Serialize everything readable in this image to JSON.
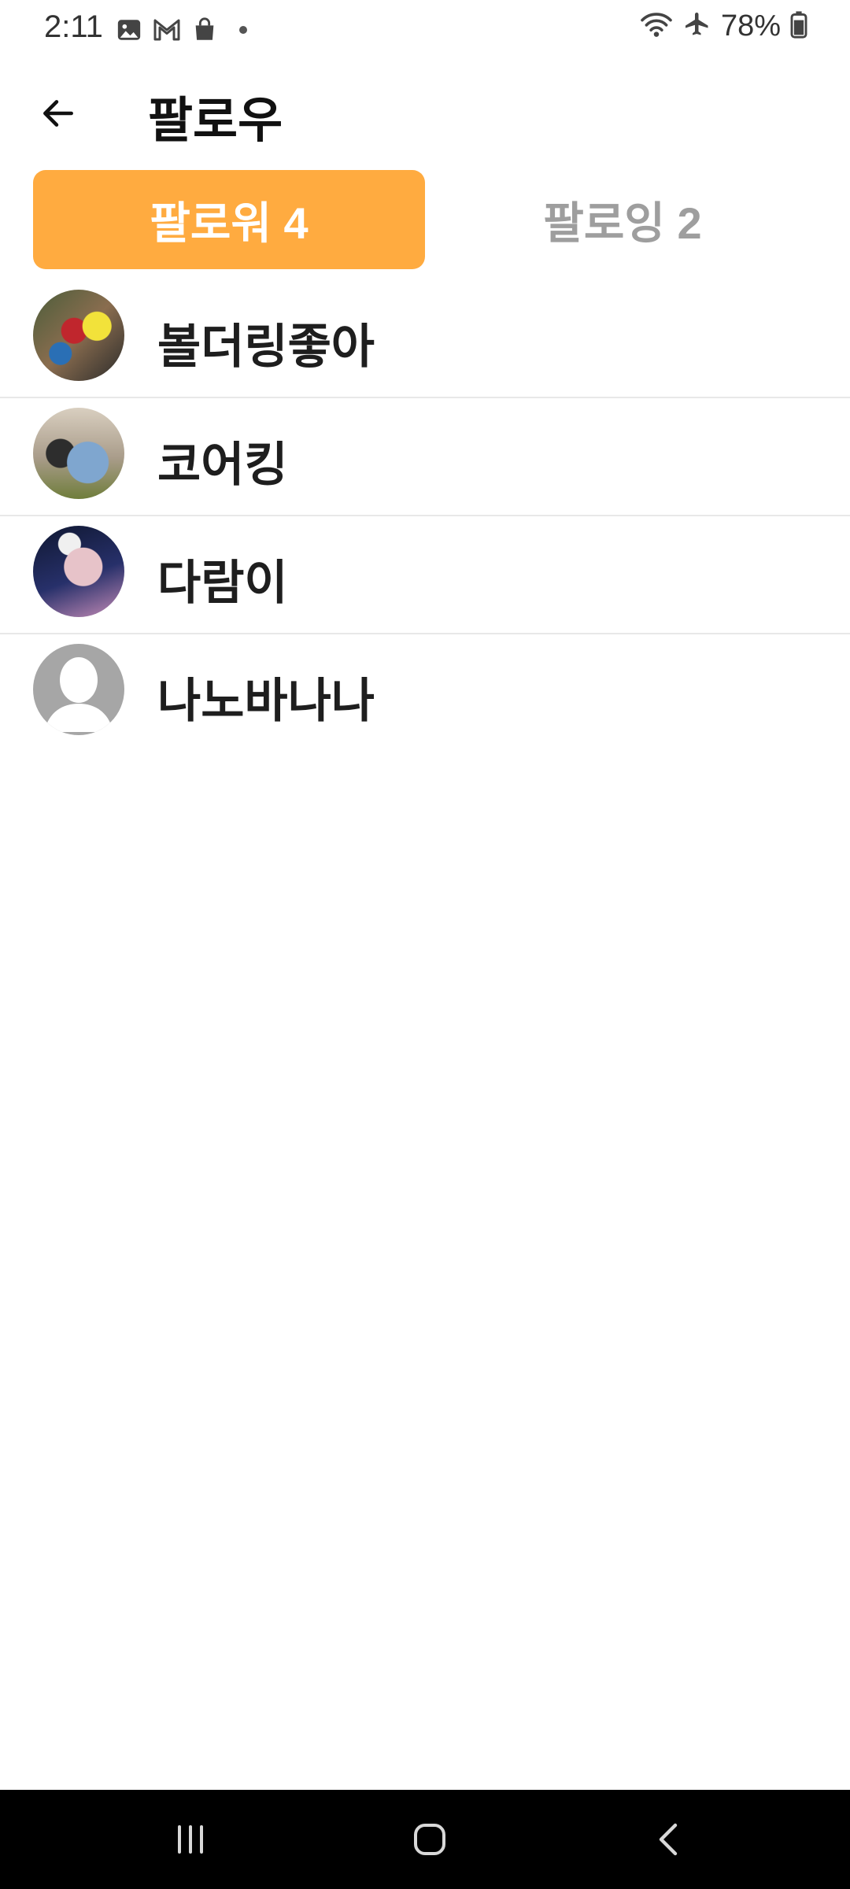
{
  "status_bar": {
    "time": "2:11",
    "battery": "78%",
    "icons_left": [
      "gallery-icon",
      "gmail-icon",
      "shopping-bag-icon",
      "notification-dot"
    ],
    "icons_right": [
      "wifi-icon",
      "airplane-mode-icon",
      "battery-icon"
    ]
  },
  "app_bar": {
    "title": "팔로우",
    "back_icon": "arrow-left-icon"
  },
  "tabs": [
    {
      "label": "팔로워 4",
      "selected": true
    },
    {
      "label": "팔로잉 2",
      "selected": false
    }
  ],
  "followers": [
    {
      "name": "볼더링좋아",
      "avatar": "photo"
    },
    {
      "name": "코어킹",
      "avatar": "photo"
    },
    {
      "name": "다람이",
      "avatar": "photo"
    },
    {
      "name": "나노바나나",
      "avatar": "default-person-icon"
    }
  ],
  "colors": {
    "accent": "#ffab40",
    "tab_inactive_text": "#9e9e9e",
    "divider": "#e8e8e8",
    "nav_bar": "#000000"
  },
  "nav_bar": {
    "buttons": [
      "recents-icon",
      "home-icon",
      "back-icon"
    ]
  }
}
